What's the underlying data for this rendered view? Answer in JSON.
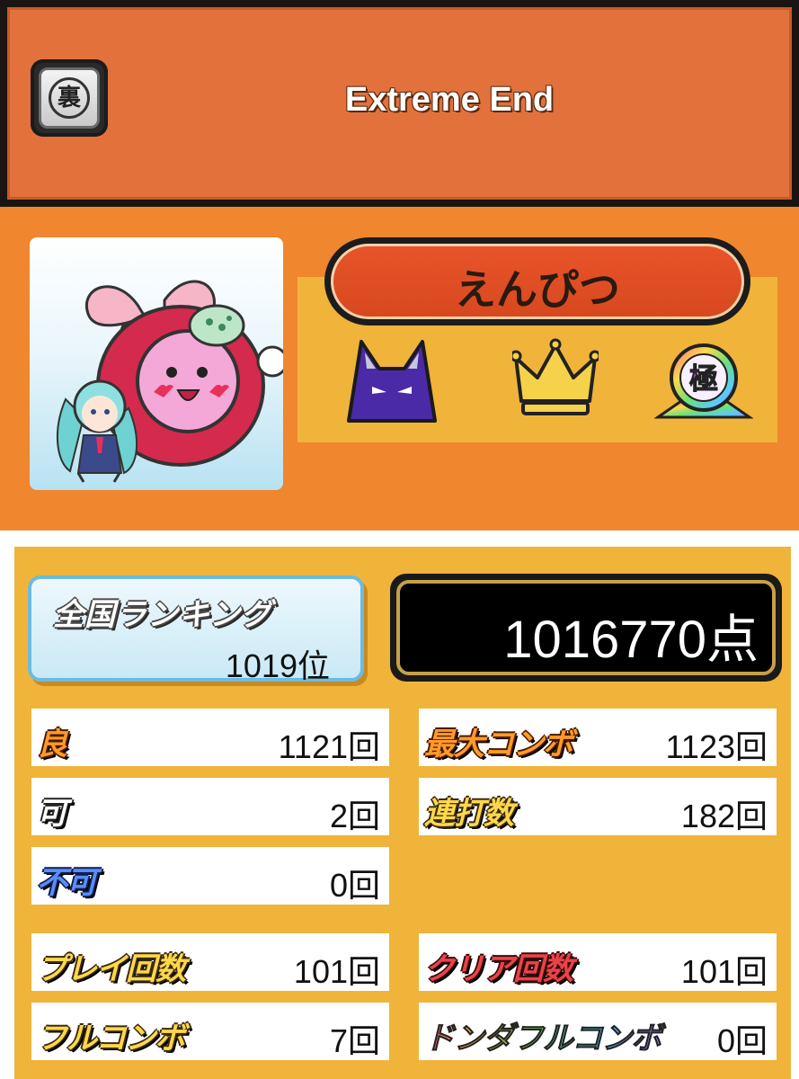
{
  "song": {
    "title": "Extreme End",
    "difficulty_icon_text": "裏"
  },
  "player": {
    "name": "えんぴつ",
    "badges": [
      "oni-difficulty-icon",
      "gold-crown-icon",
      "kiwami-rank-icon"
    ],
    "kiwami_text": "極"
  },
  "ranking": {
    "label": "全国ランキング",
    "value": "1019位"
  },
  "score": {
    "value": "1016770点"
  },
  "stats": {
    "good": {
      "label": "良",
      "value": "1121回"
    },
    "max_combo": {
      "label": "最大コンボ",
      "value": "1123回"
    },
    "ok": {
      "label": "可",
      "value": "2回"
    },
    "drumroll": {
      "label": "連打数",
      "value": "182回"
    },
    "bad": {
      "label": "不可",
      "value": "0回"
    },
    "play_count": {
      "label": "プレイ回数",
      "value": "101回"
    },
    "clear_count": {
      "label": "クリア回数",
      "value": "101回"
    },
    "full_combo": {
      "label": "フルコンボ",
      "value": "7回"
    },
    "donderful": {
      "label": "ドンダフルコンボ",
      "value": "0回"
    }
  },
  "colors": {
    "background": "#f0862e",
    "panel": "#f0b43a",
    "title_bar": "#e2713b",
    "name_plate": "#e0502a"
  }
}
